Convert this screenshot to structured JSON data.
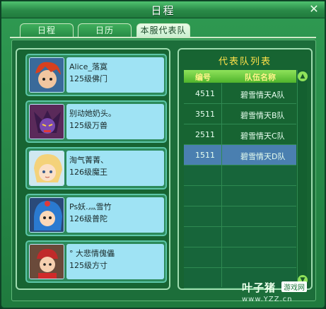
{
  "window": {
    "title": "日程",
    "close_glyph": "✕"
  },
  "tabs": [
    {
      "label": "日程",
      "active": false
    },
    {
      "label": "日历",
      "active": false
    },
    {
      "label": "本服代表队",
      "active": true
    }
  ],
  "members": [
    {
      "name": "Alice_落寞",
      "level": "125级佛门",
      "avatar": "avatar-red-hair-boy"
    },
    {
      "name": "别动她奶头。",
      "level": "125级万兽",
      "avatar": "avatar-demon-warrior"
    },
    {
      "name": "淘气菁菁、",
      "level": "126级魔王",
      "avatar": "avatar-blonde-girl"
    },
    {
      "name": "Ps妖.灬雪竹",
      "level": "126级普陀",
      "avatar": "avatar-blue-hair-girl"
    },
    {
      "name": "° 大悲情傀儡",
      "level": "125级方寸",
      "avatar": "avatar-red-cap-kid"
    }
  ],
  "team_list": {
    "title": "代表队列表",
    "headers": {
      "id": "编号",
      "name": "队伍名称"
    },
    "rows": [
      {
        "id": "4511",
        "name": "碧雪情天A队",
        "selected": false
      },
      {
        "id": "3511",
        "name": "碧雪情天B队",
        "selected": false
      },
      {
        "id": "2511",
        "name": "碧雪情天C队",
        "selected": false
      },
      {
        "id": "1511",
        "name": "碧雪情天D队",
        "selected": true
      }
    ],
    "empty_rows": 6
  },
  "watermark": {
    "brand": "叶子猪",
    "tag": "游戏网",
    "url": "www.YZZ.cn"
  },
  "colors": {
    "window_green": "#1f7a3e",
    "selected_row": "#4a7fb0",
    "title_yellow": "#ffe24a",
    "info_cyan": "#9fe3f4"
  }
}
